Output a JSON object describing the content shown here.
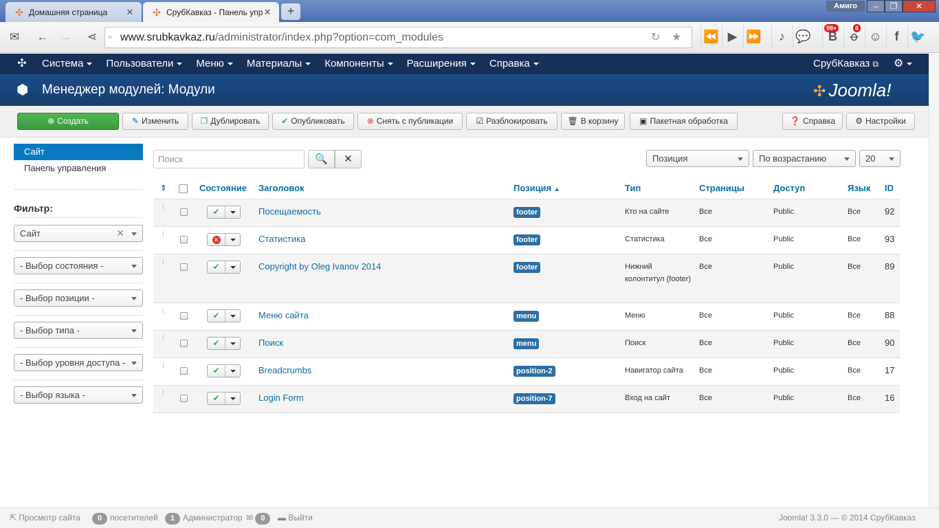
{
  "browser": {
    "tabs": [
      {
        "title": "Домашняя страница",
        "active": false
      },
      {
        "title": "СрубКавказ - Панель управления",
        "active": true
      }
    ],
    "profile": "Амиго",
    "url_host": "www.srubkavkaz.ru",
    "url_path": "/administrator/index.php?option=com_modules",
    "badges": {
      "vk": "99+",
      "ok": "8"
    },
    "ext_labels": {
      "vk": "B",
      "fb": "f"
    }
  },
  "nav": {
    "items": [
      "Система",
      "Пользователи",
      "Меню",
      "Материалы",
      "Компоненты",
      "Расширения",
      "Справка"
    ],
    "site": "СрубКавказ"
  },
  "header": {
    "title": "Менеджер модулей: Модули",
    "brand": "Joomla!"
  },
  "toolbar": {
    "new": "Создать",
    "edit": "Изменить",
    "duplicate": "Дублировать",
    "publish": "Опубликовать",
    "unpublish": "Снять с публикации",
    "checkin": "Разблокировать",
    "trash": "В корзину",
    "batch": "Пакетная обработка",
    "help": "Справка",
    "options": "Настройки"
  },
  "sidebar": {
    "items": [
      "Сайт",
      "Панель управления"
    ],
    "filter_label": "Фильтр:",
    "filters": [
      "Сайт",
      "- Выбор состояния -",
      "- Выбор позиции -",
      "- Выбор типа -",
      "- Выбор уровня доступа -",
      "- Выбор языка -"
    ]
  },
  "search": {
    "placeholder": "Поиск"
  },
  "list_controls": {
    "sort_field": "Позиция",
    "sort_dir": "По возрастанию",
    "limit": "20"
  },
  "table": {
    "headers": {
      "state": "Состояние",
      "title": "Заголовок",
      "position": "Позиция",
      "type": "Тип",
      "pages": "Страницы",
      "access": "Доступ",
      "language": "Язык",
      "id": "ID"
    },
    "rows": [
      {
        "title": "Посещаемость",
        "published": true,
        "position": "footer",
        "type": "Кто на сайте",
        "pages": "Все",
        "access": "Public",
        "language": "Все",
        "id": "92"
      },
      {
        "title": "Статистика",
        "published": false,
        "position": "footer",
        "type": "Статистика",
        "pages": "Все",
        "access": "Public",
        "language": "Все",
        "id": "93"
      },
      {
        "title": "Copyright by Oleg Ivanov 2014",
        "published": true,
        "position": "footer",
        "type": "Нижний колонтитул (footer)",
        "pages": "Все",
        "access": "Public",
        "language": "Все",
        "id": "89"
      },
      {
        "title": "Меню сайта",
        "published": true,
        "position": "menu",
        "type": "Меню",
        "pages": "Все",
        "access": "Public",
        "language": "Все",
        "id": "88"
      },
      {
        "title": "Поиск",
        "published": true,
        "position": "menu",
        "type": "Поиск",
        "pages": "Все",
        "access": "Public",
        "language": "Все",
        "id": "90"
      },
      {
        "title": "Breadcrumbs",
        "published": true,
        "position": "position-2",
        "type": "Навигатор сайта",
        "pages": "Все",
        "access": "Public",
        "language": "Все",
        "id": "17"
      },
      {
        "title": "Login Form",
        "published": true,
        "position": "position-7",
        "type": "Вход на сайт",
        "pages": "Все",
        "access": "Public",
        "language": "Все",
        "id": "16"
      }
    ]
  },
  "status": {
    "view_site": "Просмотр сайта",
    "visitors_count": "0",
    "visitors_label": "посетителей",
    "admins_count": "1",
    "admins_label": "Администратор",
    "messages_count": "0",
    "logout": "Выйти",
    "copyright": "Joomla! 3.3.0 — © 2014 СрубКавказ"
  },
  "colors": {
    "nav_bg": "#17305a",
    "header_bg": "#1a4c85",
    "accent": "#0a7abf",
    "link": "#0b6ea8",
    "success": "#46a546",
    "danger": "#d33333"
  }
}
